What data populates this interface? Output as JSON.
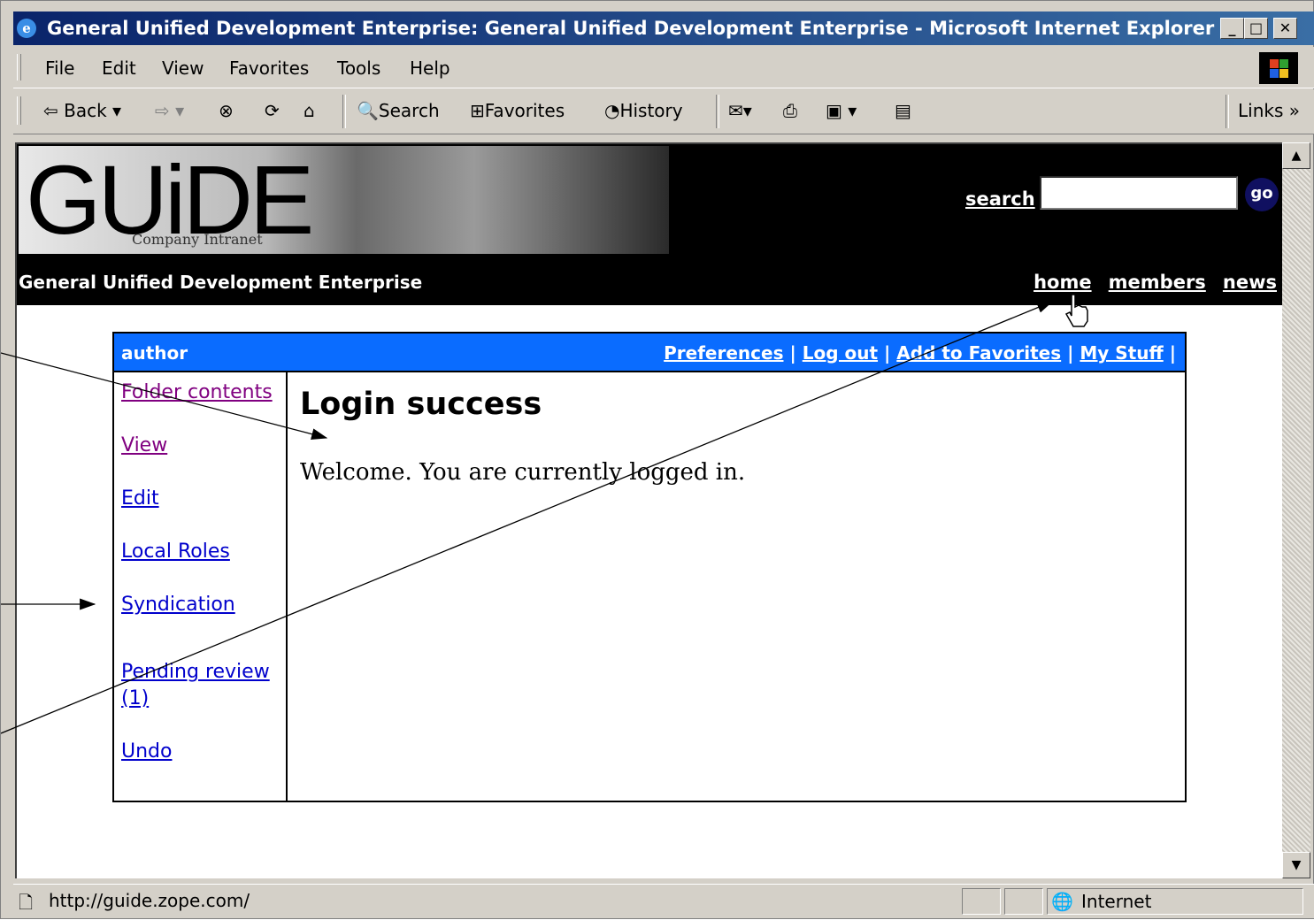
{
  "window": {
    "title": "General Unified Development Enterprise: General Unified Development Enterprise - Microsoft Internet Explorer"
  },
  "menu": [
    "File",
    "Edit",
    "View",
    "Favorites",
    "Tools",
    "Help"
  ],
  "toolbar": {
    "back": "Back",
    "search": "Search",
    "favorites": "Favorites",
    "history": "History",
    "links": "Links"
  },
  "site": {
    "logo": "GUiDE",
    "logo_sub": "Company Intranet",
    "search_label": "search",
    "search_value": "",
    "go_label": "go",
    "name": "General Unified Development Enterprise",
    "nav": [
      "home",
      "members",
      "news"
    ]
  },
  "userbar": {
    "user": "author",
    "links": [
      "Preferences",
      "Log out",
      "Add to Favorites",
      "My Stuff"
    ],
    "separator": "|"
  },
  "sidebar": [
    "Folder contents",
    "View",
    "Edit",
    "Local Roles",
    "Syndication",
    "Pending review",
    "(1)",
    "Undo"
  ],
  "main": {
    "heading": "Login success",
    "message": "Welcome. You are currently logged in."
  },
  "status": {
    "url": "http://guide.zope.com/",
    "zone": "Internet"
  },
  "colors": {
    "userbar": "#0a6cff",
    "header": "#000000",
    "link": "#0000cc",
    "visited": "#800080"
  }
}
